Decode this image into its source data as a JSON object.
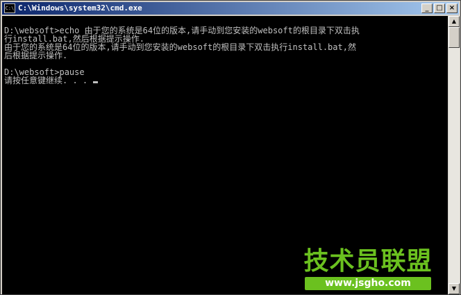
{
  "window": {
    "title": "C:\\Windows\\system32\\cmd.exe",
    "icon_text": "C:\\",
    "buttons": {
      "minimize": "_",
      "maximize": "□",
      "close": "×"
    }
  },
  "console": {
    "lines": [
      "D:\\websoft>echo 由于您的系统是64位的版本,请手动到您安装的websoft的根目录下双击执",
      "行install.bat,然后根据提示操作.",
      "由于您的系统是64位的版本,请手动到您安装的websoft的根目录下双击执行install.bat,然",
      "后根据提示操作.",
      "",
      "D:\\websoft>pause",
      "请按任意键继续. . . "
    ]
  },
  "scrollbar": {
    "up_arrow": "▲",
    "down_arrow": "▼"
  },
  "watermark": {
    "logo_text": "技术员联盟",
    "url": "www.jsgho.com"
  },
  "colors": {
    "console_bg": "#000000",
    "console_text": "#c0c0c0",
    "titlebar_start": "#0a246a",
    "titlebar_end": "#a6caf0",
    "watermark_green": "#6bc11f"
  }
}
